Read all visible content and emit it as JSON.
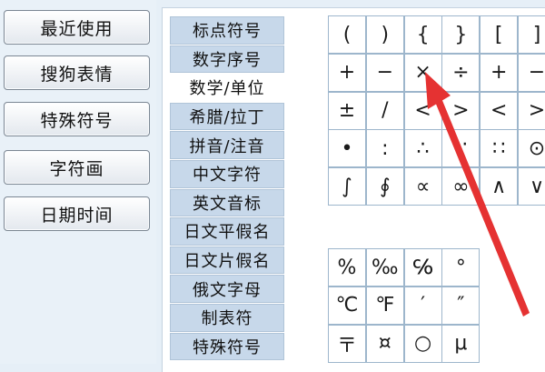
{
  "left_buttons": [
    "最近使用",
    "搜狗表情",
    "特殊符号",
    "字符画",
    "日期时间"
  ],
  "categories": [
    "标点符号",
    "数字序号",
    "数学/单位",
    "希腊/拉丁",
    "拼音/注音",
    "中文字符",
    "英文音标",
    "日文平假名",
    "日文片假名",
    "俄文字母",
    "制表符",
    "特殊符号"
  ],
  "selected_category": "数学/单位",
  "symbols_top": [
    [
      "(",
      ")",
      "{",
      "}",
      "[",
      "]"
    ],
    [
      "+",
      "−",
      "×",
      "÷",
      "+",
      "−"
    ],
    [
      "±",
      "/",
      "<",
      ">",
      "<",
      ">"
    ],
    [
      "•",
      ":",
      "∴",
      "∵",
      "∷",
      "⊙"
    ],
    [
      "∫",
      "∮",
      "∝",
      "∞",
      "∧",
      "∨"
    ]
  ],
  "symbols_bottom": [
    [
      "%",
      "‰",
      "℅",
      "°"
    ],
    [
      "℃",
      "℉",
      "′",
      "″"
    ],
    [
      "〒",
      "¤",
      "○",
      "μ"
    ]
  ],
  "colors": {
    "arrow": "#e53232",
    "selected_bg": "#ffffff",
    "category_bg": "#c7d8ea",
    "grid_border": "#9db6cc"
  }
}
